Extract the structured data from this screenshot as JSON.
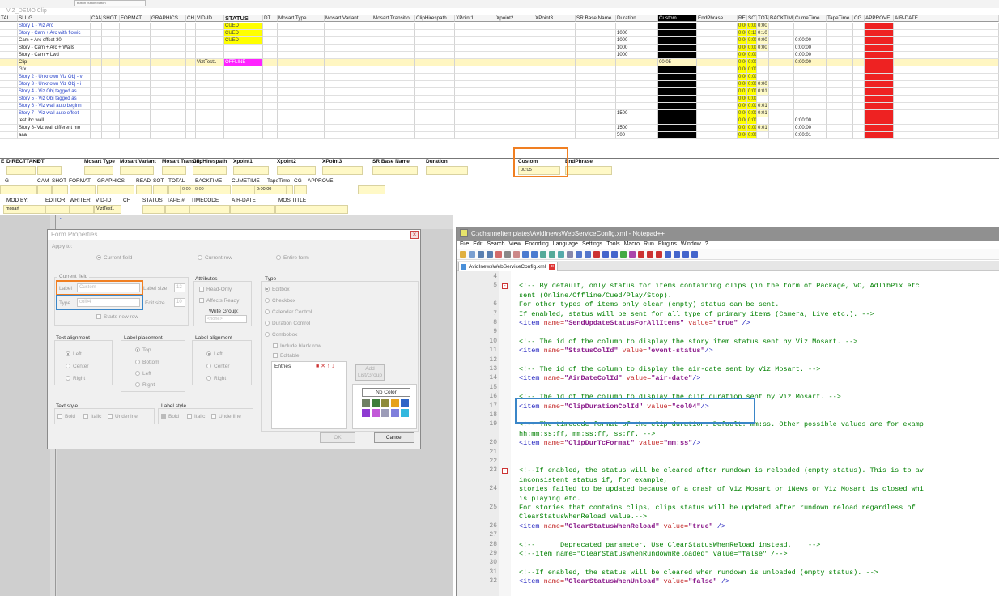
{
  "top": {
    "toolbar_button": "button button button",
    "grid_title": "VIZ_DEMO Clip"
  },
  "grid": {
    "headers": [
      "TAL",
      "SLUG",
      "CAM",
      "SHOT",
      "FORMAT",
      "GRAPHICS",
      "CH",
      "VID-ID",
      "STATUS",
      "DT",
      "Mosart Type",
      "Mosart Variant",
      "Mosart Transitio",
      "ClipHirespath",
      "XPoint1",
      "Xpoint2",
      "XPoint3",
      "SR Base Name",
      "Duration",
      "Custom",
      "EndPhrase",
      "READ",
      "SOT",
      "TOTA",
      "BACKTIME",
      "CumeTime",
      "TapeTime",
      "CG",
      "APPROVE",
      "AIR-DATE"
    ],
    "rows": [
      {
        "slug": "Story 1 - Viz Arc",
        "blue": true,
        "vid": "",
        "status": "CUED",
        "duration": "",
        "custom": "",
        "read": "0:00",
        "sot": "0:00",
        "tota": "0:00",
        "cume": ""
      },
      {
        "slug": "Story - Cam + Arc with flowic",
        "blue": true,
        "vid": "",
        "status": "CUED",
        "duration": "1000",
        "custom": "",
        "read": "0:00",
        "sot": "0:10",
        "tota": "0:10",
        "cume": ""
      },
      {
        "slug": "Cam + Arc offset 30",
        "blue": false,
        "vid": "",
        "status": "CUED",
        "duration": "1000",
        "custom": "",
        "read": "0:00",
        "sot": "0:00",
        "tota": "0:00",
        "cume": "0:00:00"
      },
      {
        "slug": "Story - Cam + Arc + Walls",
        "blue": false,
        "vid": "",
        "status": "",
        "duration": "1000",
        "custom": "",
        "read": "0:00",
        "sot": "0:00",
        "tota": "0:00",
        "cume": "0:00:00"
      },
      {
        "slug": "Story - Cam + Lwd",
        "blue": false,
        "vid": "",
        "status": "",
        "duration": "1000",
        "custom": "",
        "read": "0:00",
        "sot": "0:00",
        "tota": "",
        "cume": "0:00:00"
      },
      {
        "slug": "Clip",
        "blue": false,
        "vid": "ViztTest1",
        "status": "OFFLINE",
        "duration": "",
        "custom": "00:05",
        "read": "0:00",
        "sot": "0:00",
        "tota": "",
        "cume": "0:00:00",
        "selected": true
      },
      {
        "slug": "Gfx",
        "blue": false,
        "vid": "",
        "status": "",
        "duration": "",
        "custom": "",
        "read": "0:00",
        "sot": "0:00",
        "tota": "",
        "cume": ""
      },
      {
        "slug": "Story 2 - Unknown Viz Obj - v",
        "blue": true,
        "vid": "",
        "status": "",
        "duration": "",
        "custom": "",
        "read": "0:00",
        "sot": "0:00",
        "tota": "",
        "cume": ""
      },
      {
        "slug": "Story 3 - Unknown Viz Obj - i",
        "blue": true,
        "vid": "",
        "status": "",
        "duration": "",
        "custom": "",
        "read": "0:00",
        "sot": "0:00",
        "tota": "0:00",
        "cume": ""
      },
      {
        "slug": "Story 4 - Viz Obj tagged as",
        "blue": true,
        "vid": "",
        "status": "",
        "duration": "",
        "custom": "",
        "read": "0:01",
        "sot": "0:00",
        "tota": "0:01",
        "cume": ""
      },
      {
        "slug": "Story 5 - Viz Obj tagged as",
        "blue": true,
        "vid": "",
        "status": "",
        "duration": "",
        "custom": "",
        "read": "0:00",
        "sot": "0:00",
        "tota": "",
        "cume": ""
      },
      {
        "slug": "Story 6 - Viz wall auto beginn",
        "blue": true,
        "vid": "",
        "status": "",
        "duration": "",
        "custom": "",
        "read": "0:00",
        "sot": "0:01",
        "tota": "0:01",
        "cume": ""
      },
      {
        "slug": "Story 7 - Viz wall auto offset",
        "blue": true,
        "vid": "",
        "status": "",
        "duration": "1500",
        "custom": "",
        "read": "0:00",
        "sot": "0:01",
        "tota": "0:01",
        "cume": ""
      },
      {
        "slug": "test ibc wall",
        "blue": false,
        "vid": "",
        "status": "",
        "duration": "",
        "custom": "",
        "read": "0:00",
        "sot": "0:00",
        "tota": "",
        "cume": "0:00:00"
      },
      {
        "slug": "Story 8- Viz wall different mo",
        "blue": false,
        "vid": "",
        "status": "",
        "duration": "1500",
        "custom": "",
        "read": "0:01",
        "sot": "0:00",
        "tota": "0:01",
        "cume": "0:00:00"
      },
      {
        "slug": "aaa",
        "blue": false,
        "vid": "",
        "status": "",
        "duration": "500",
        "custom": "",
        "read": "0:00",
        "sot": "0:00",
        "tota": "",
        "cume": "0:00:01"
      }
    ]
  },
  "strip": {
    "row1": [
      "E",
      "DIRECTTAKE",
      "DT",
      "Mosart Type",
      "Mosart Variant",
      "Mosart Transitic",
      "ClipHirespath",
      "Xpoint1",
      "Xpoint2",
      "XPoint3",
      "SR Base Name",
      "Duration",
      "Custom",
      "EndPhrase"
    ],
    "custom_value": "00:05",
    "row2": [
      "G",
      "CAM",
      "SHOT",
      "FORMAT",
      "GRAPHICS",
      "READ",
      "SOT",
      "TOTAL",
      "BACKTIME",
      "CUMETIME",
      "TapeTime",
      "CG",
      "APPROVE"
    ],
    "read": "0:00",
    "sot": "0:00",
    "cumetime": "0:00:00",
    "row3": [
      "MOD BY:",
      "EDITOR",
      "WRITER",
      "VID-ID",
      "CH",
      "STATUS",
      "TAPE #",
      "TIMECODE",
      "AIR-DATE",
      "MOS TITLE"
    ],
    "modby": "mosart",
    "vidid": "ViztTest1"
  },
  "dialog": {
    "title": "Form Properties",
    "apply_to": "Apply to:",
    "apply_options": [
      "Current field",
      "Current row",
      "Entire form"
    ],
    "current_field": "Current field",
    "label_label": "Label",
    "label_value": "Custom",
    "type_label": "Type",
    "type_value": "col04",
    "label_size": "Label size",
    "label_size_value": "12",
    "edit_size": "Edit size",
    "edit_size_value": "10",
    "starts_new_row": "Starts new row",
    "attributes": "Attributes",
    "attr_items": [
      "Read-Only",
      "Affects Ready"
    ],
    "write_group": "Write Group:",
    "write_group_value": "<none>",
    "type_group": "Type",
    "type_options": [
      "Editbox",
      "Checkbox",
      "Calendar Control",
      "Duration Control",
      "Combobox"
    ],
    "include_blank": "Include blank row",
    "editable": "Editable",
    "entries": "Entries",
    "add_listgroup": "Add List/Group",
    "no_color": "No Color",
    "text_alignment": "Text alignment",
    "align_options": [
      "Left",
      "Center",
      "Right"
    ],
    "label_placement": "Label placement",
    "placement_options": [
      "Top",
      "Bottom",
      "Left",
      "Right"
    ],
    "label_alignment": "Label alignment",
    "label_align_options": [
      "Left",
      "Center",
      "Right"
    ],
    "text_style": "Text style",
    "label_style": "Label style",
    "style_options": [
      "Bold",
      "Italic",
      "Underline"
    ],
    "ok": "OK",
    "cancel": "Cancel",
    "swatch_colors": [
      "#6e7f63",
      "#3f7d3b",
      "#8e8a3a",
      "#e6a21c",
      "#2c64c7",
      "#8e3bd1",
      "#c25ad8",
      "#9c9cb8",
      "#7f7fdc",
      "#32b8de"
    ]
  },
  "notepad": {
    "title": "C:\\channeltemplates\\AvidInewsWebServiceConfig.xml - Notepad++",
    "menu": [
      "File",
      "Edit",
      "Search",
      "View",
      "Encoding",
      "Language",
      "Settings",
      "Tools",
      "Macro",
      "Run",
      "Plugins",
      "Window",
      "?"
    ],
    "tab": "AvidInewsWebServiceConfig.xml",
    "lines": [
      {
        "n": "4",
        "parts": []
      },
      {
        "n": "5",
        "fold": true,
        "parts": [
          [
            "c",
            "<!-- By default, only status for items containing clips (in the form of Package, VO, AdlibPix etc"
          ]
        ]
      },
      {
        "n": "",
        "parts": [
          [
            "c",
            "sent (Online/Offline/Cued/Play/Stop)."
          ]
        ]
      },
      {
        "n": "6",
        "parts": [
          [
            "c",
            "For other types of items only clear (empty) status can be sent."
          ]
        ]
      },
      {
        "n": "7",
        "parts": [
          [
            "c",
            "If enabled, status will be sent for all type of primary items (Camera, Live etc.). -->"
          ]
        ]
      },
      {
        "n": "8",
        "parts": [
          [
            "t",
            "<item "
          ],
          [
            "a",
            "name="
          ],
          [
            "v",
            "\"SendUpdateStatusForAllItems\""
          ],
          [
            "a",
            " value="
          ],
          [
            "v",
            "\"true\""
          ],
          [
            "t",
            " />"
          ]
        ]
      },
      {
        "n": "9",
        "parts": []
      },
      {
        "n": "10",
        "parts": [
          [
            "c",
            "<!-- The id of the column to display the story item status sent by Viz Mosart. -->"
          ]
        ]
      },
      {
        "n": "11",
        "parts": [
          [
            "t",
            "<item "
          ],
          [
            "a",
            "name="
          ],
          [
            "v",
            "\"StatusColId\""
          ],
          [
            "a",
            " value="
          ],
          [
            "v",
            "\"event-status\""
          ],
          [
            "t",
            "/>"
          ]
        ]
      },
      {
        "n": "12",
        "parts": []
      },
      {
        "n": "13",
        "parts": [
          [
            "c",
            "<!-- The id of the column to display the air-date sent by Viz Mosart. -->"
          ]
        ]
      },
      {
        "n": "14",
        "parts": [
          [
            "t",
            "<item "
          ],
          [
            "a",
            "name="
          ],
          [
            "v",
            "\"AirDateColId\""
          ],
          [
            "a",
            " value="
          ],
          [
            "v",
            "\"air-date\""
          ],
          [
            "t",
            "/>"
          ]
        ]
      },
      {
        "n": "15",
        "parts": []
      },
      {
        "n": "16",
        "parts": [
          [
            "c",
            "<!-- The id of the column to display the clip duration sent by Viz Mosart. -->"
          ]
        ]
      },
      {
        "n": "17",
        "parts": [
          [
            "t",
            "<item "
          ],
          [
            "a",
            "name="
          ],
          [
            "v",
            "\"ClipDurationColId\""
          ],
          [
            "a",
            " value="
          ],
          [
            "v",
            "\"col04\""
          ],
          [
            "t",
            "/>"
          ]
        ]
      },
      {
        "n": "18",
        "parts": []
      },
      {
        "n": "19",
        "parts": [
          [
            "c",
            "<!-- The timecode format of the clip duration. Default: mm:ss. Other possible values are for examp"
          ]
        ]
      },
      {
        "n": "",
        "parts": [
          [
            "c",
            "hh:mm:ss:ff, mm:ss:ff, ss:ff. -->"
          ]
        ]
      },
      {
        "n": "20",
        "parts": [
          [
            "t",
            "<item "
          ],
          [
            "a",
            "name="
          ],
          [
            "v",
            "\"ClipDurTcFormat\""
          ],
          [
            "a",
            " value="
          ],
          [
            "v",
            "\"mm:ss\""
          ],
          [
            "t",
            "/>"
          ]
        ]
      },
      {
        "n": "21",
        "parts": []
      },
      {
        "n": "22",
        "parts": []
      },
      {
        "n": "23",
        "fold": true,
        "parts": [
          [
            "c",
            "<!--If enabled, the status will be cleared after rundown is reloaded (empty status). This is to av"
          ]
        ]
      },
      {
        "n": "",
        "parts": [
          [
            "c",
            "inconsistent status if, for example,"
          ]
        ]
      },
      {
        "n": "24",
        "parts": [
          [
            "c",
            "stories failed to be updated because of a crash of Viz Mosart or iNews or Viz Mosart is closed whi"
          ]
        ]
      },
      {
        "n": "",
        "parts": [
          [
            "c",
            "is playing etc."
          ]
        ]
      },
      {
        "n": "25",
        "parts": [
          [
            "c",
            "For stories that contains clips, clips status will be updated after rundown reload regardless of"
          ]
        ]
      },
      {
        "n": "",
        "parts": [
          [
            "c",
            "ClearStatusWhenReload value.-->"
          ]
        ]
      },
      {
        "n": "26",
        "parts": [
          [
            "t",
            "<item "
          ],
          [
            "a",
            "name="
          ],
          [
            "v",
            "\"ClearStatusWhenReload\""
          ],
          [
            "a",
            " value="
          ],
          [
            "v",
            "\"true\""
          ],
          [
            "t",
            " />"
          ]
        ]
      },
      {
        "n": "27",
        "parts": []
      },
      {
        "n": "28",
        "parts": [
          [
            "c",
            "<!--      Deprecated parameter. Use ClearStatusWhenReload instead.    -->"
          ]
        ]
      },
      {
        "n": "29",
        "parts": [
          [
            "c",
            "<!--item name=\"ClearStatusWhenRundownReloaded\" value=\"false\" /-->"
          ]
        ]
      },
      {
        "n": "30",
        "parts": []
      },
      {
        "n": "31",
        "parts": [
          [
            "c",
            "<!--If enabled, the status will be cleared when rundown is unloaded (empty status). -->"
          ]
        ]
      },
      {
        "n": "32",
        "parts": [
          [
            "t",
            "<item "
          ],
          [
            "a",
            "name="
          ],
          [
            "v",
            "\"ClearStatusWhenUnload\""
          ],
          [
            "a",
            " value="
          ],
          [
            "v",
            "\"false\""
          ],
          [
            "t",
            " />"
          ]
        ]
      }
    ]
  }
}
